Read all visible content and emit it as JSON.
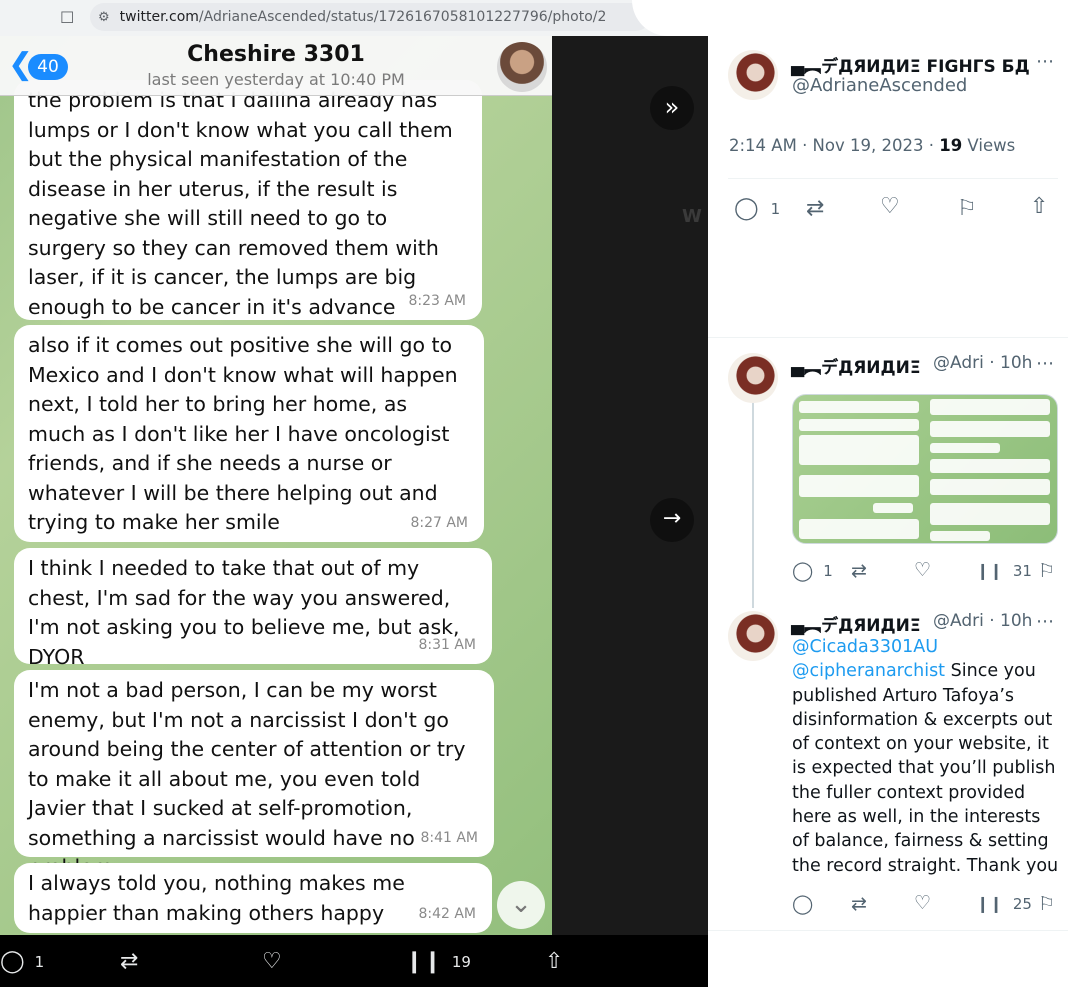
{
  "browser": {
    "url_host": "twitter.com",
    "url_path": "/AdrianeAscended/status/1726167058101227796/photo/2"
  },
  "chat": {
    "back_count": "40",
    "name": "Cheshire 3301",
    "status": "last seen yesterday at 10:40 PM",
    "messages": [
      {
        "text": "the problem is that I dalilna already has lumps or I don't know what you call them but the physical manifestation of the disease in her uterus, if the result is negative she will still need to go to surgery so they can removed them with laser, if it is cancer, the lumps are big enough to be cancer in it's advance form....",
        "time": "8:23 AM"
      },
      {
        "text": "also if it comes out positive she will go to Mexico and I don't know what will happen next, I told her to bring her home, as much as I don't like her I have oncologist friends, and if she needs a nurse or whatever I will be there helping out and trying to make her smile",
        "time": "8:27 AM"
      },
      {
        "text": "I think I needed to take that out of my chest, I'm sad for the way you answered, I'm not asking you to believe me, but ask, DYOR",
        "time": "8:31 AM"
      },
      {
        "text": "I'm not a bad person, I can be my worst enemy, but I'm  not a narcissist I don't go around being the center of attention or try to make it all about me, you even told Javier that I sucked at self-promotion, something a narcissist would have no problem.",
        "time": "8:41 AM"
      },
      {
        "text": "I always told you, nothing makes me happier than making others happy",
        "time": "8:42 AM"
      }
    ]
  },
  "photo_actions": {
    "reply_count": "1",
    "views_count": "19"
  },
  "main_tweet": {
    "display_name": "▄︻デДЯИДИΞ FIGHΓS БД",
    "handle": "@AdrianeAscended",
    "time": "2:14 AM · Nov 19, 2023 · ",
    "views_num": "19",
    "views_label": " Views",
    "reply_count": "1"
  },
  "reply1": {
    "display_name": "▄︻デДЯИДИΞ",
    "handle_time": "@Adri · 10h",
    "reply_count": "1",
    "views_count": "31"
  },
  "reply2": {
    "display_name": "▄︻デДЯИДИΞ",
    "handle_time": "@Adri · 10h",
    "mention1": "@Cicada3301AU",
    "mention2": "@cipheranarchist",
    "body": "Since you published Arturo Tafoya’s disinformation & excerpts out of context on your website, it is expected that you’ll publish the fuller context provided here as well, in the interests of balance, fairness & setting the record straight. Thank you",
    "views_count": "25"
  },
  "icons": {
    "reply": "reply-icon",
    "retweet": "retweet-icon",
    "like": "heart-icon",
    "bookmark": "bookmark-icon",
    "share": "share-icon",
    "views": "views-icon"
  },
  "colors": {
    "twitter_blue": "#1d9bf0",
    "telegram_blue": "#1a8cff",
    "chat_bg": "#a7ca8e"
  }
}
